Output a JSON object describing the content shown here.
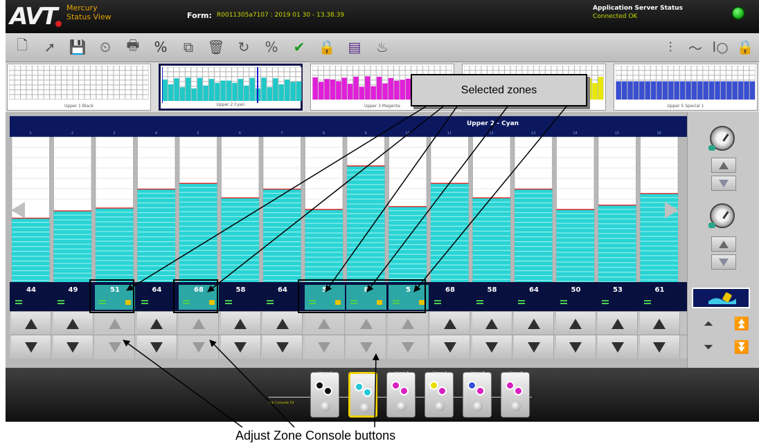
{
  "app": {
    "logo": "AVT",
    "name_line1": "Mercury",
    "name_line2": "Status View",
    "form_label": "Form:",
    "form_value": "R0011305a7107 : 2019 01 30 - 13.38.39",
    "server_label": "Application Server Status",
    "server_value": "Connected OK",
    "server_status_color": "#1bb41b"
  },
  "toolbar": {
    "left_icons": [
      "new-page-icon",
      "export-icon",
      "save-icon",
      "timer-icon",
      "print-icon",
      "percent-dial-icon",
      "copy-icon",
      "trash-icon",
      "refresh-icon",
      "percent-icon",
      "check-icon",
      "lock-icon",
      "report-icon",
      "ink-icon"
    ],
    "right_icons": [
      "density-icon",
      "curve-icon",
      "io-icon",
      "lock-icon"
    ]
  },
  "strip": {
    "thumbs": [
      {
        "label": "Upper 1 Black",
        "color": "#f0f0f0",
        "active": false
      },
      {
        "label": "Upper 2 Cyan",
        "color": "#20c8c8",
        "active": true
      },
      {
        "label": "Upper 3 Magenta",
        "color": "#e020d8",
        "active": false
      },
      {
        "label": "Upper 4 Yellow",
        "color": "#e8e800",
        "active": false
      },
      {
        "label": "Upper 5 Special 1",
        "color": "#3a4fd0",
        "active": false
      }
    ]
  },
  "unit": {
    "title": "Upper 2 - Cyan",
    "ink_color": "#2ad4d4",
    "zone_numbers": [
      "1",
      "2",
      "3",
      "4",
      "5",
      "6",
      "7",
      "8",
      "9",
      "10",
      "11",
      "12",
      "13",
      "14",
      "15",
      "16"
    ],
    "zones": [
      {
        "value": "44",
        "level": 44,
        "selected": false
      },
      {
        "value": "49",
        "level": 49,
        "selected": false
      },
      {
        "value": "51",
        "level": 51,
        "selected": true
      },
      {
        "value": "64",
        "level": 64,
        "selected": false
      },
      {
        "value": "68",
        "level": 68,
        "selected": true
      },
      {
        "value": "58",
        "level": 58,
        "selected": false
      },
      {
        "value": "64",
        "level": 64,
        "selected": false
      },
      {
        "value": "5",
        "level": 50,
        "selected": true
      },
      {
        "value": "8",
        "level": 80,
        "selected": true
      },
      {
        "value": "5",
        "level": 52,
        "selected": true
      },
      {
        "value": "68",
        "level": 68,
        "selected": false
      },
      {
        "value": "58",
        "level": 58,
        "selected": false
      },
      {
        "value": "64",
        "level": 64,
        "selected": false
      },
      {
        "value": "50",
        "level": 50,
        "selected": false
      },
      {
        "value": "53",
        "level": 53,
        "selected": false
      },
      {
        "value": "61",
        "level": 61,
        "selected": false
      }
    ]
  },
  "bottom": {
    "row_label": "Ink Console 01",
    "units": [
      {
        "label": "Upper 1",
        "c1": "#111111",
        "c2": "#111111",
        "active": false
      },
      {
        "label": "Upper 2",
        "c1": "#22c8d8",
        "c2": "#22c8d8",
        "active": true
      },
      {
        "label": "Upper 3",
        "c1": "#d820c0",
        "c2": "#d820c0",
        "active": false
      },
      {
        "label": "Upper 4",
        "c1": "#e8e000",
        "c2": "#d820c0",
        "active": false
      },
      {
        "label": "Upper 5",
        "c1": "#3a50d8",
        "c2": "#d820c0",
        "active": false
      },
      {
        "label": "Upper 6",
        "c1": "#d820c0",
        "c2": "#d820c0",
        "active": false
      }
    ]
  },
  "annotations": {
    "selected_zones": "Selected zones",
    "adjust_buttons": "Adjust Zone Console buttons"
  }
}
